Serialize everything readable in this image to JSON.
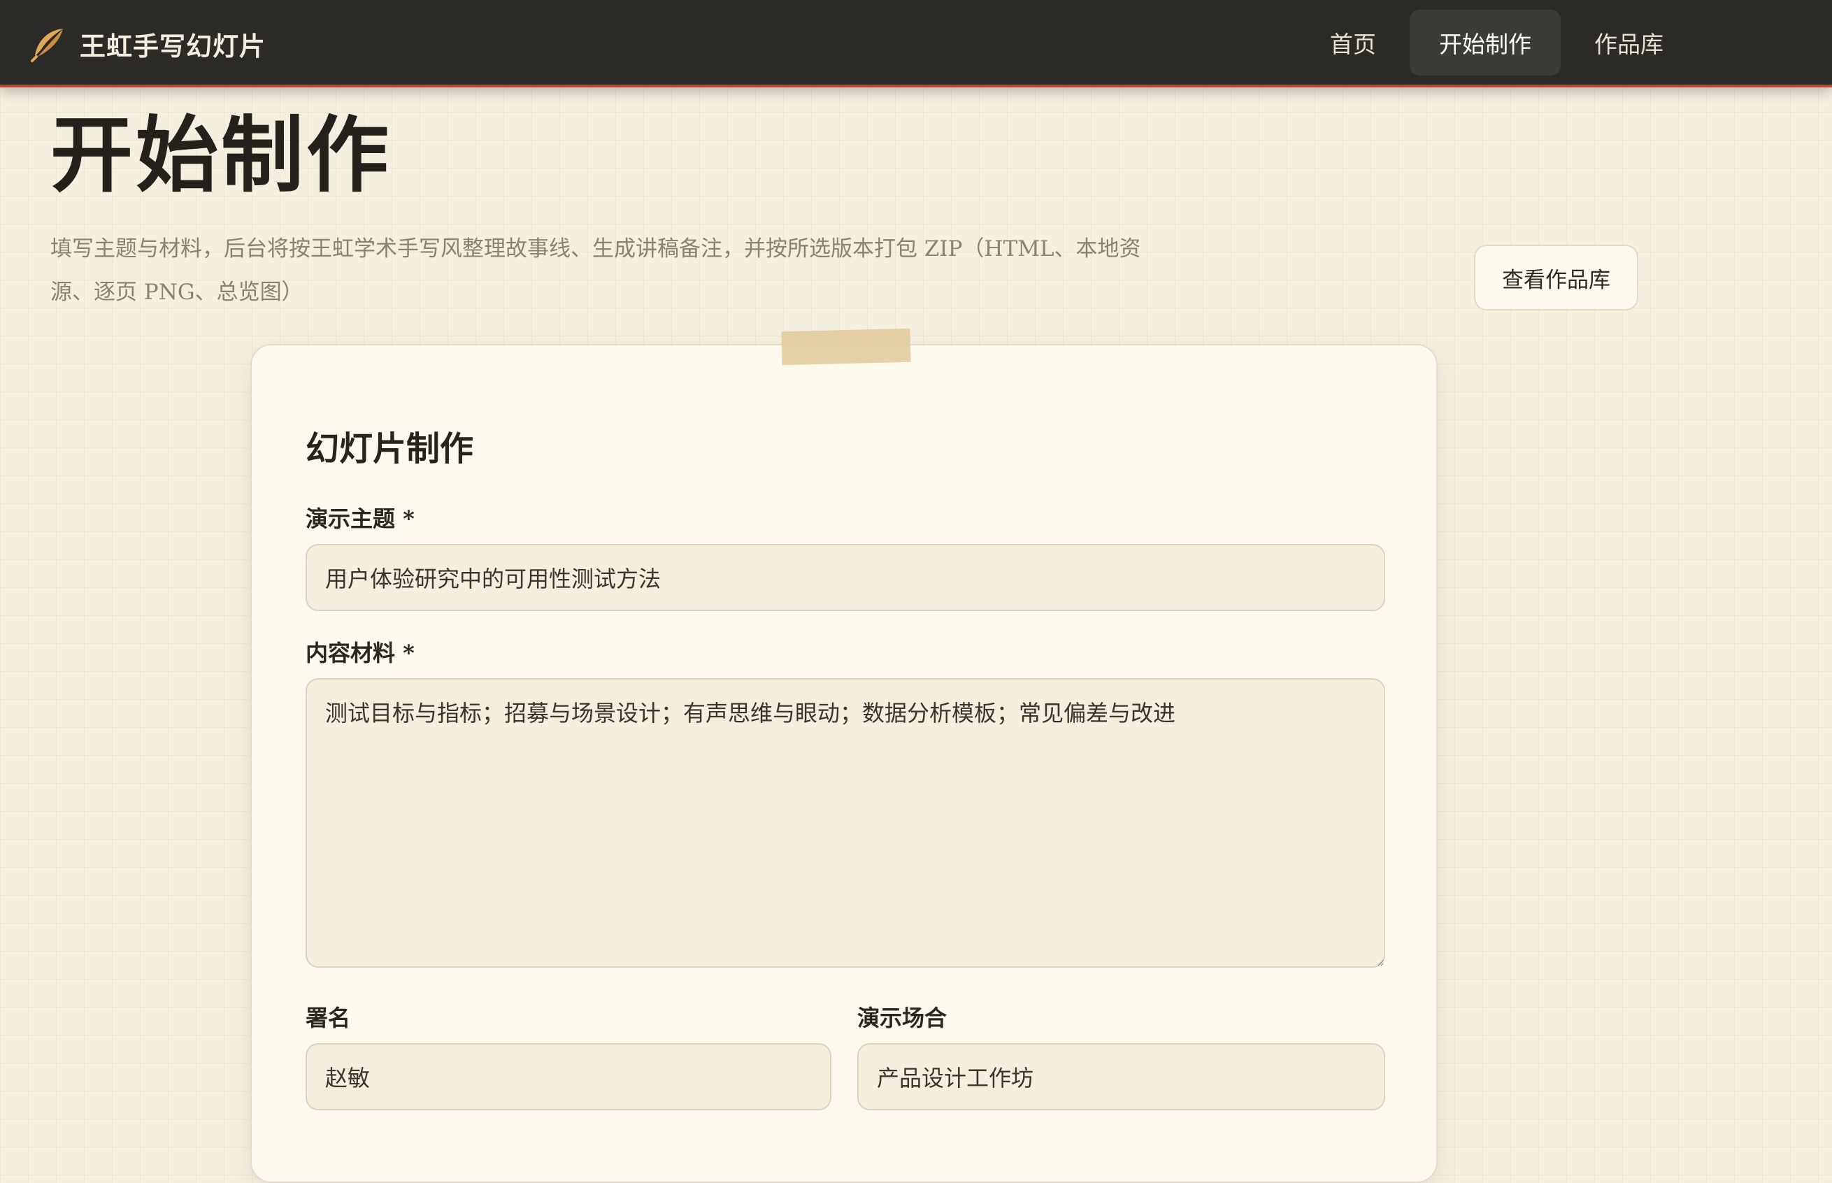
{
  "app": {
    "brand_name": "王虹手写幻灯片",
    "brand_icon": "feather-icon",
    "accent_color": "#e0a85a"
  },
  "nav": {
    "items": [
      {
        "label": "首页",
        "active": false
      },
      {
        "label": "开始制作",
        "active": true
      },
      {
        "label": "作品库",
        "active": false
      }
    ]
  },
  "header": {
    "title": "开始制作",
    "subtitle": "填写主题与材料，后台将按王虹学术手写风整理故事线、生成讲稿备注，并按所选版本打包 ZIP（HTML、本地资源、逐页 PNG、总览图）",
    "gallery_button": "查看作品库"
  },
  "form": {
    "title": "幻灯片制作",
    "topic": {
      "label": "演示主题 *",
      "value": "用户体验研究中的可用性测试方法"
    },
    "materials": {
      "label": "内容材料 *",
      "value": "测试目标与指标；招募与场景设计；有声思维与眼动；数据分析模板；常见偏差与改进"
    },
    "author": {
      "label": "署名",
      "value": "赵敏"
    },
    "occasion": {
      "label": "演示场合",
      "value": "产品设计工作坊"
    }
  }
}
